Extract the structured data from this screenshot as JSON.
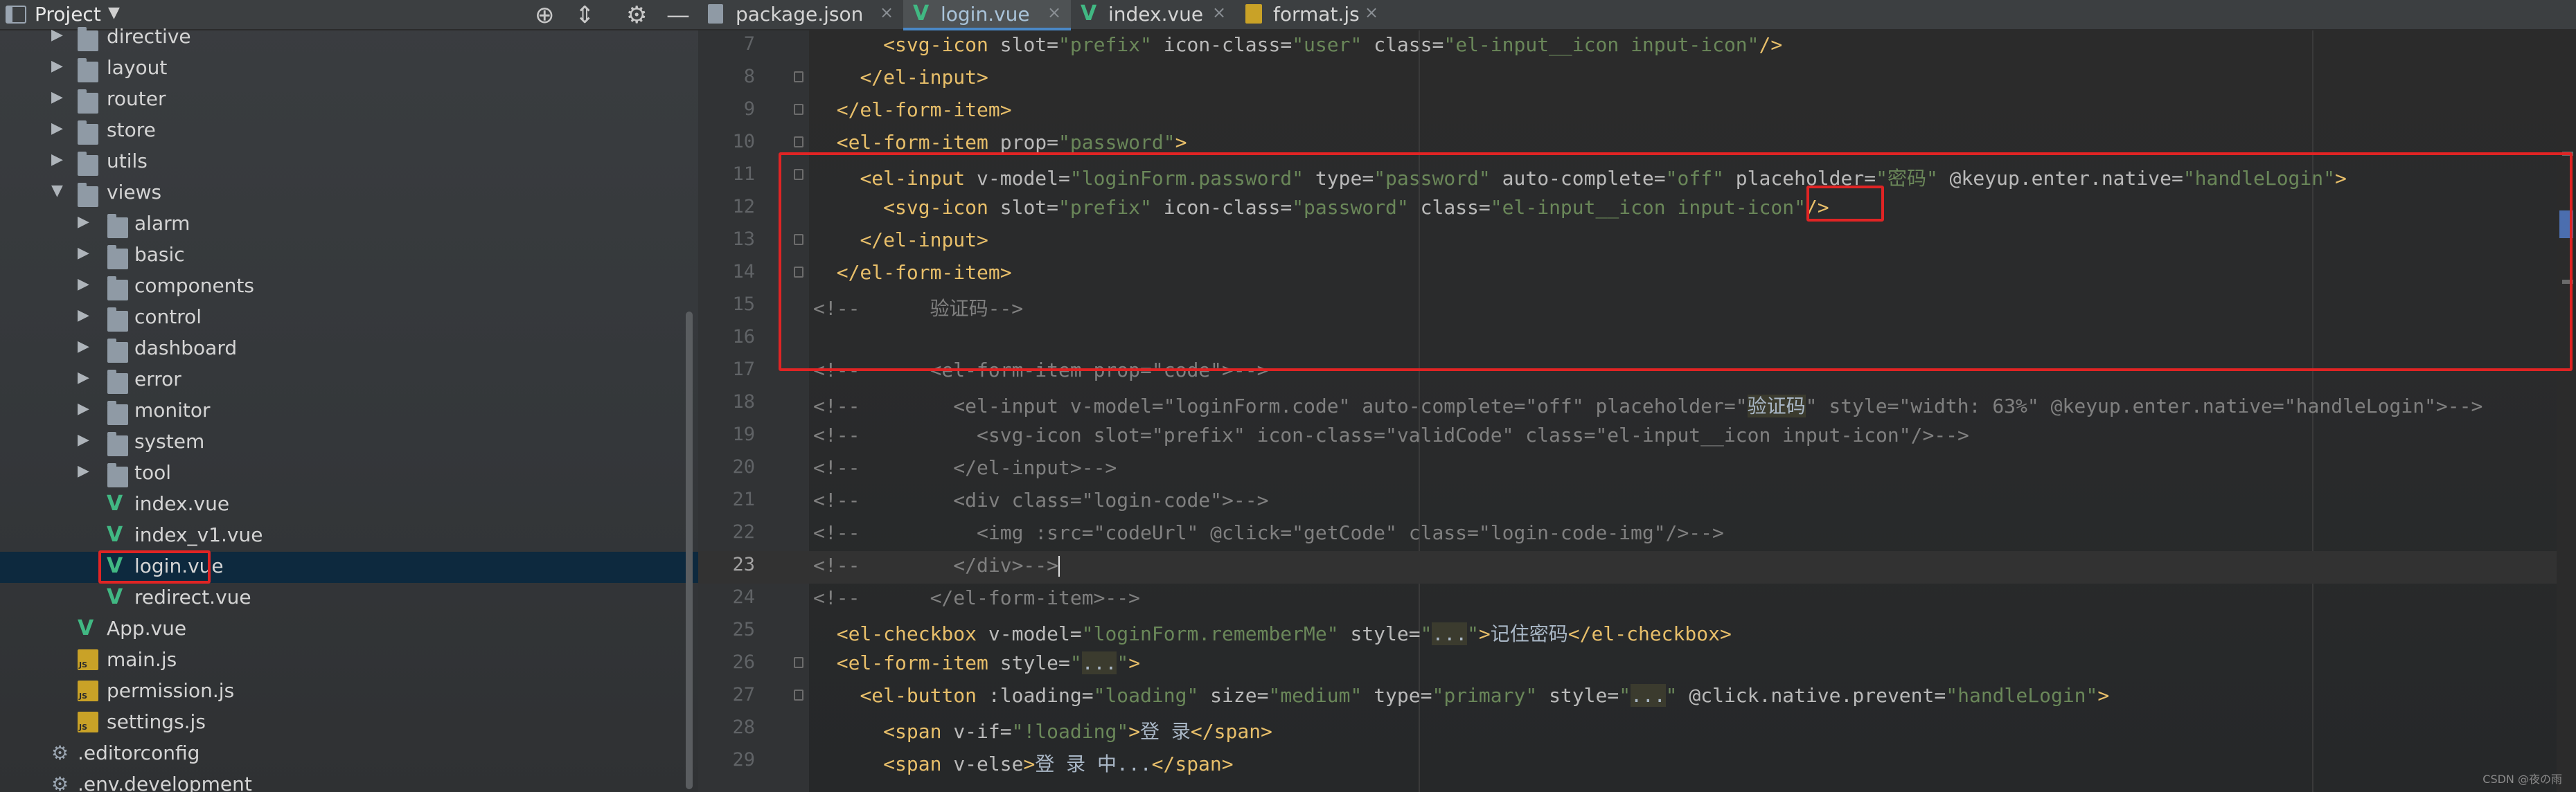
{
  "project": {
    "title": "Project",
    "tree": [
      {
        "label": "directive",
        "kind": "folder",
        "depth": 1,
        "expanded": false
      },
      {
        "label": "layout",
        "kind": "folder",
        "depth": 1,
        "expanded": false
      },
      {
        "label": "router",
        "kind": "folder",
        "depth": 1,
        "expanded": false
      },
      {
        "label": "store",
        "kind": "folder",
        "depth": 1,
        "expanded": false
      },
      {
        "label": "utils",
        "kind": "folder",
        "depth": 1,
        "expanded": false
      },
      {
        "label": "views",
        "kind": "folder",
        "depth": 1,
        "expanded": true
      },
      {
        "label": "alarm",
        "kind": "folder",
        "depth": 2,
        "expanded": false
      },
      {
        "label": "basic",
        "kind": "folder",
        "depth": 2,
        "expanded": false
      },
      {
        "label": "components",
        "kind": "folder",
        "depth": 2,
        "expanded": false
      },
      {
        "label": "control",
        "kind": "folder",
        "depth": 2,
        "expanded": false
      },
      {
        "label": "dashboard",
        "kind": "folder",
        "depth": 2,
        "expanded": false
      },
      {
        "label": "error",
        "kind": "folder",
        "depth": 2,
        "expanded": false
      },
      {
        "label": "monitor",
        "kind": "folder",
        "depth": 2,
        "expanded": false
      },
      {
        "label": "system",
        "kind": "folder",
        "depth": 2,
        "expanded": false
      },
      {
        "label": "tool",
        "kind": "folder",
        "depth": 2,
        "expanded": false
      },
      {
        "label": "index.vue",
        "kind": "vue",
        "depth": 2
      },
      {
        "label": "index_v1.vue",
        "kind": "vue",
        "depth": 2
      },
      {
        "label": "login.vue",
        "kind": "vue",
        "depth": 2,
        "selected": true
      },
      {
        "label": "redirect.vue",
        "kind": "vue",
        "depth": 2
      },
      {
        "label": "App.vue",
        "kind": "vue",
        "depth": 1
      },
      {
        "label": "main.js",
        "kind": "js",
        "depth": 1
      },
      {
        "label": "permission.js",
        "kind": "js",
        "depth": 1
      },
      {
        "label": "settings.js",
        "kind": "js",
        "depth": 1
      },
      {
        "label": ".editorconfig",
        "kind": "config",
        "depth": 0
      },
      {
        "label": ".env.development",
        "kind": "config",
        "depth": 0
      }
    ]
  },
  "tabs": [
    {
      "label": "package.json",
      "icon": "json-file-icon",
      "active": false
    },
    {
      "label": "login.vue",
      "icon": "vue-file-icon",
      "active": true
    },
    {
      "label": "index.vue",
      "icon": "vue-file-icon",
      "active": false
    },
    {
      "label": "format.js",
      "icon": "js-file-icon",
      "active": false
    }
  ],
  "editor": {
    "current_line": 23,
    "lines": [
      {
        "n": "7",
        "fold": false,
        "tokens": [
          [
            "      ",
            "txt"
          ],
          [
            "<svg-icon ",
            "tag"
          ],
          [
            "slot=",
            "attr"
          ],
          [
            "\"prefix\" ",
            "str"
          ],
          [
            "icon-class=",
            "attr"
          ],
          [
            "\"user\" ",
            "str"
          ],
          [
            "class=",
            "attr"
          ],
          [
            "\"el-input__icon input-icon\"",
            "str"
          ],
          [
            "/>",
            "tag"
          ]
        ]
      },
      {
        "n": "8",
        "fold": true,
        "tokens": [
          [
            "    ",
            "txt"
          ],
          [
            "</el-input>",
            "tag"
          ]
        ]
      },
      {
        "n": "9",
        "fold": true,
        "tokens": [
          [
            "  ",
            "txt"
          ],
          [
            "</el-form-item>",
            "tag"
          ]
        ]
      },
      {
        "n": "10",
        "fold": true,
        "tokens": [
          [
            "  ",
            "txt"
          ],
          [
            "<el-form-item ",
            "tag"
          ],
          [
            "prop=",
            "attr"
          ],
          [
            "\"password\"",
            "str"
          ],
          [
            ">",
            "tag"
          ]
        ]
      },
      {
        "n": "11",
        "fold": true,
        "tokens": [
          [
            "    ",
            "txt"
          ],
          [
            "<el-input ",
            "tag"
          ],
          [
            "v-model=",
            "attr"
          ],
          [
            "\"loginForm.password\" ",
            "str"
          ],
          [
            "type=",
            "attr"
          ],
          [
            "\"password\" ",
            "str"
          ],
          [
            "auto-complete=",
            "attr"
          ],
          [
            "\"off\" ",
            "str"
          ],
          [
            "placeholder=",
            "attr"
          ],
          [
            "\"密码\" ",
            "str"
          ],
          [
            "@keyup.enter.native=",
            "attr"
          ],
          [
            "\"handleLogin\"",
            "str"
          ],
          [
            ">",
            "tag"
          ]
        ]
      },
      {
        "n": "12",
        "fold": false,
        "tokens": [
          [
            "      ",
            "txt"
          ],
          [
            "<svg-icon ",
            "tag"
          ],
          [
            "slot=",
            "attr"
          ],
          [
            "\"prefix\" ",
            "str"
          ],
          [
            "icon-class=",
            "attr"
          ],
          [
            "\"password\" ",
            "str"
          ],
          [
            "class=",
            "attr"
          ],
          [
            "\"el-input__icon input-icon\"",
            "str"
          ],
          [
            "/>",
            "tag"
          ]
        ]
      },
      {
        "n": "13",
        "fold": true,
        "tokens": [
          [
            "    ",
            "txt"
          ],
          [
            "</el-input>",
            "tag"
          ]
        ]
      },
      {
        "n": "14",
        "fold": true,
        "tokens": [
          [
            "  ",
            "txt"
          ],
          [
            "</el-form-item>",
            "tag"
          ]
        ]
      },
      {
        "n": "15",
        "fold": false,
        "tokens": [
          [
            "<!--      验证码-->",
            "com"
          ]
        ]
      },
      {
        "n": "16",
        "fold": false,
        "tokens": []
      },
      {
        "n": "17",
        "fold": false,
        "tokens": [
          [
            "<!--      <el-form-item prop=\"code\">-->",
            "com"
          ]
        ]
      },
      {
        "n": "18",
        "fold": false,
        "tokens": [
          [
            "<!--        <el-input v-model=\"loginForm.code\" auto-complete=\"off\" placeholder=\"",
            "com"
          ],
          [
            "验证码",
            "hl"
          ],
          [
            "\" style=\"width: 63%\" @keyup.enter.native=\"handleLogin\">-->",
            "com"
          ]
        ]
      },
      {
        "n": "19",
        "fold": false,
        "tokens": [
          [
            "<!--          <svg-icon slot=\"prefix\" icon-class=\"validCode\" class=\"el-input__icon input-icon\"/>-->",
            "com"
          ]
        ]
      },
      {
        "n": "20",
        "fold": false,
        "tokens": [
          [
            "<!--        </el-input>-->",
            "com"
          ]
        ]
      },
      {
        "n": "21",
        "fold": false,
        "tokens": [
          [
            "<!--        <div class=\"login-code\">-->",
            "com"
          ]
        ]
      },
      {
        "n": "22",
        "fold": false,
        "tokens": [
          [
            "<!--          <img :src=\"codeUrl\" @click=\"getCode\" class=\"login-code-img\"/>-->",
            "com"
          ]
        ]
      },
      {
        "n": "23",
        "fold": false,
        "tokens": [
          [
            "<!--        </div>-->",
            "com"
          ]
        ],
        "caret": true
      },
      {
        "n": "24",
        "fold": false,
        "tokens": [
          [
            "<!--      </el-form-item>-->",
            "com"
          ]
        ]
      },
      {
        "n": "25",
        "fold": false,
        "tokens": [
          [
            "  ",
            "txt"
          ],
          [
            "<el-checkbox ",
            "tag"
          ],
          [
            "v-model=",
            "attr"
          ],
          [
            "\"loginForm.rememberMe\" ",
            "str"
          ],
          [
            "style=",
            "attr"
          ],
          [
            "\"",
            "str"
          ],
          [
            "...",
            "hl"
          ],
          [
            "\"",
            "str"
          ],
          [
            ">",
            "tag"
          ],
          [
            "记住密码",
            "txt"
          ],
          [
            "</el-checkbox>",
            "tag"
          ]
        ]
      },
      {
        "n": "26",
        "fold": true,
        "tokens": [
          [
            "  ",
            "txt"
          ],
          [
            "<el-form-item ",
            "tag"
          ],
          [
            "style=",
            "attr"
          ],
          [
            "\"",
            "str"
          ],
          [
            "...",
            "hl"
          ],
          [
            "\"",
            "str"
          ],
          [
            ">",
            "tag"
          ]
        ]
      },
      {
        "n": "27",
        "fold": true,
        "tokens": [
          [
            "    ",
            "txt"
          ],
          [
            "<el-button ",
            "tag"
          ],
          [
            ":loading=",
            "attr"
          ],
          [
            "\"loading\" ",
            "str"
          ],
          [
            "size=",
            "attr"
          ],
          [
            "\"medium\" ",
            "str"
          ],
          [
            "type=",
            "attr"
          ],
          [
            "\"primary\" ",
            "str"
          ],
          [
            "style=",
            "attr"
          ],
          [
            "\"",
            "str"
          ],
          [
            "...",
            "hl"
          ],
          [
            "\" ",
            "str"
          ],
          [
            "@click.native.prevent=",
            "attr"
          ],
          [
            "\"handleLogin\"",
            "str"
          ],
          [
            ">",
            "tag"
          ]
        ]
      },
      {
        "n": "28",
        "fold": false,
        "tokens": [
          [
            "      ",
            "txt"
          ],
          [
            "<span ",
            "tag"
          ],
          [
            "v-if=",
            "attr"
          ],
          [
            "\"!loading\"",
            "str"
          ],
          [
            ">",
            "tag"
          ],
          [
            "登 录",
            "txt"
          ],
          [
            "</span>",
            "tag"
          ]
        ]
      },
      {
        "n": "29",
        "fold": false,
        "tokens": [
          [
            "      ",
            "txt"
          ],
          [
            "<span ",
            "tag"
          ],
          [
            "v-else",
            "attr"
          ],
          [
            ">",
            "tag"
          ],
          [
            "登 录 中...",
            "txt"
          ],
          [
            "</span>",
            "tag"
          ]
        ]
      }
    ]
  },
  "watermark": "CSDN @夜の雨"
}
